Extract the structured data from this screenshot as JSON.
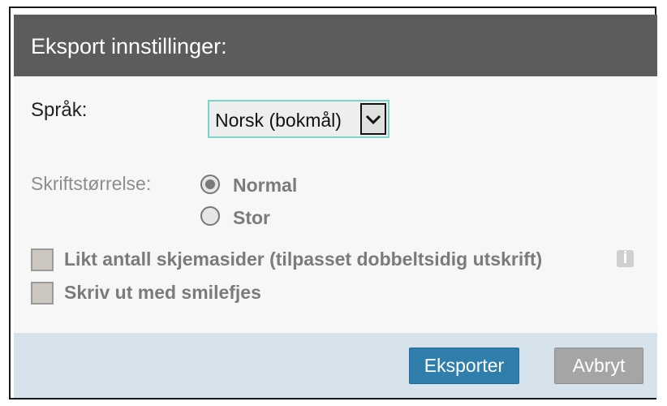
{
  "dialog": {
    "title": "Eksport innstillinger:"
  },
  "language": {
    "label": "Språk:",
    "selected": "Norsk (bokmål)",
    "icon": "chevron-down-icon"
  },
  "font_size": {
    "label": "Skriftstørrelse:",
    "options": [
      {
        "label": "Normal",
        "checked": true
      },
      {
        "label": "Stor",
        "checked": false
      }
    ]
  },
  "options": {
    "even_pages_label": "Likt antall skjemasider (tilpasset dobbeltsidig utskrift)",
    "even_pages_checked": false,
    "smiley_label": "Skriv ut med smilefjes",
    "smiley_checked": false,
    "info_icon": "info-icon"
  },
  "buttons": {
    "export_label": "Eksporter",
    "cancel_label": "Avbryt"
  },
  "colors": {
    "header": "#5c5c5c",
    "footer": "#d7e3ec",
    "export_button": "#2f7eab",
    "cancel_button": "#a5a5a5",
    "select_border": "#7cd3c8"
  }
}
